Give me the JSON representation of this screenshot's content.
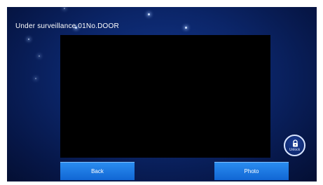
{
  "header": {
    "title": "Under surveillance 01No.DOOR"
  },
  "video": {
    "icon": "camera-feed"
  },
  "buttons": {
    "back_label": "Back",
    "photo_label": "Photo",
    "unlock_label": "Unlock",
    "unlock_icon": "lock-icon"
  },
  "colors": {
    "background": "#0b2568",
    "button": "#1a78e6",
    "video": "#000000"
  }
}
